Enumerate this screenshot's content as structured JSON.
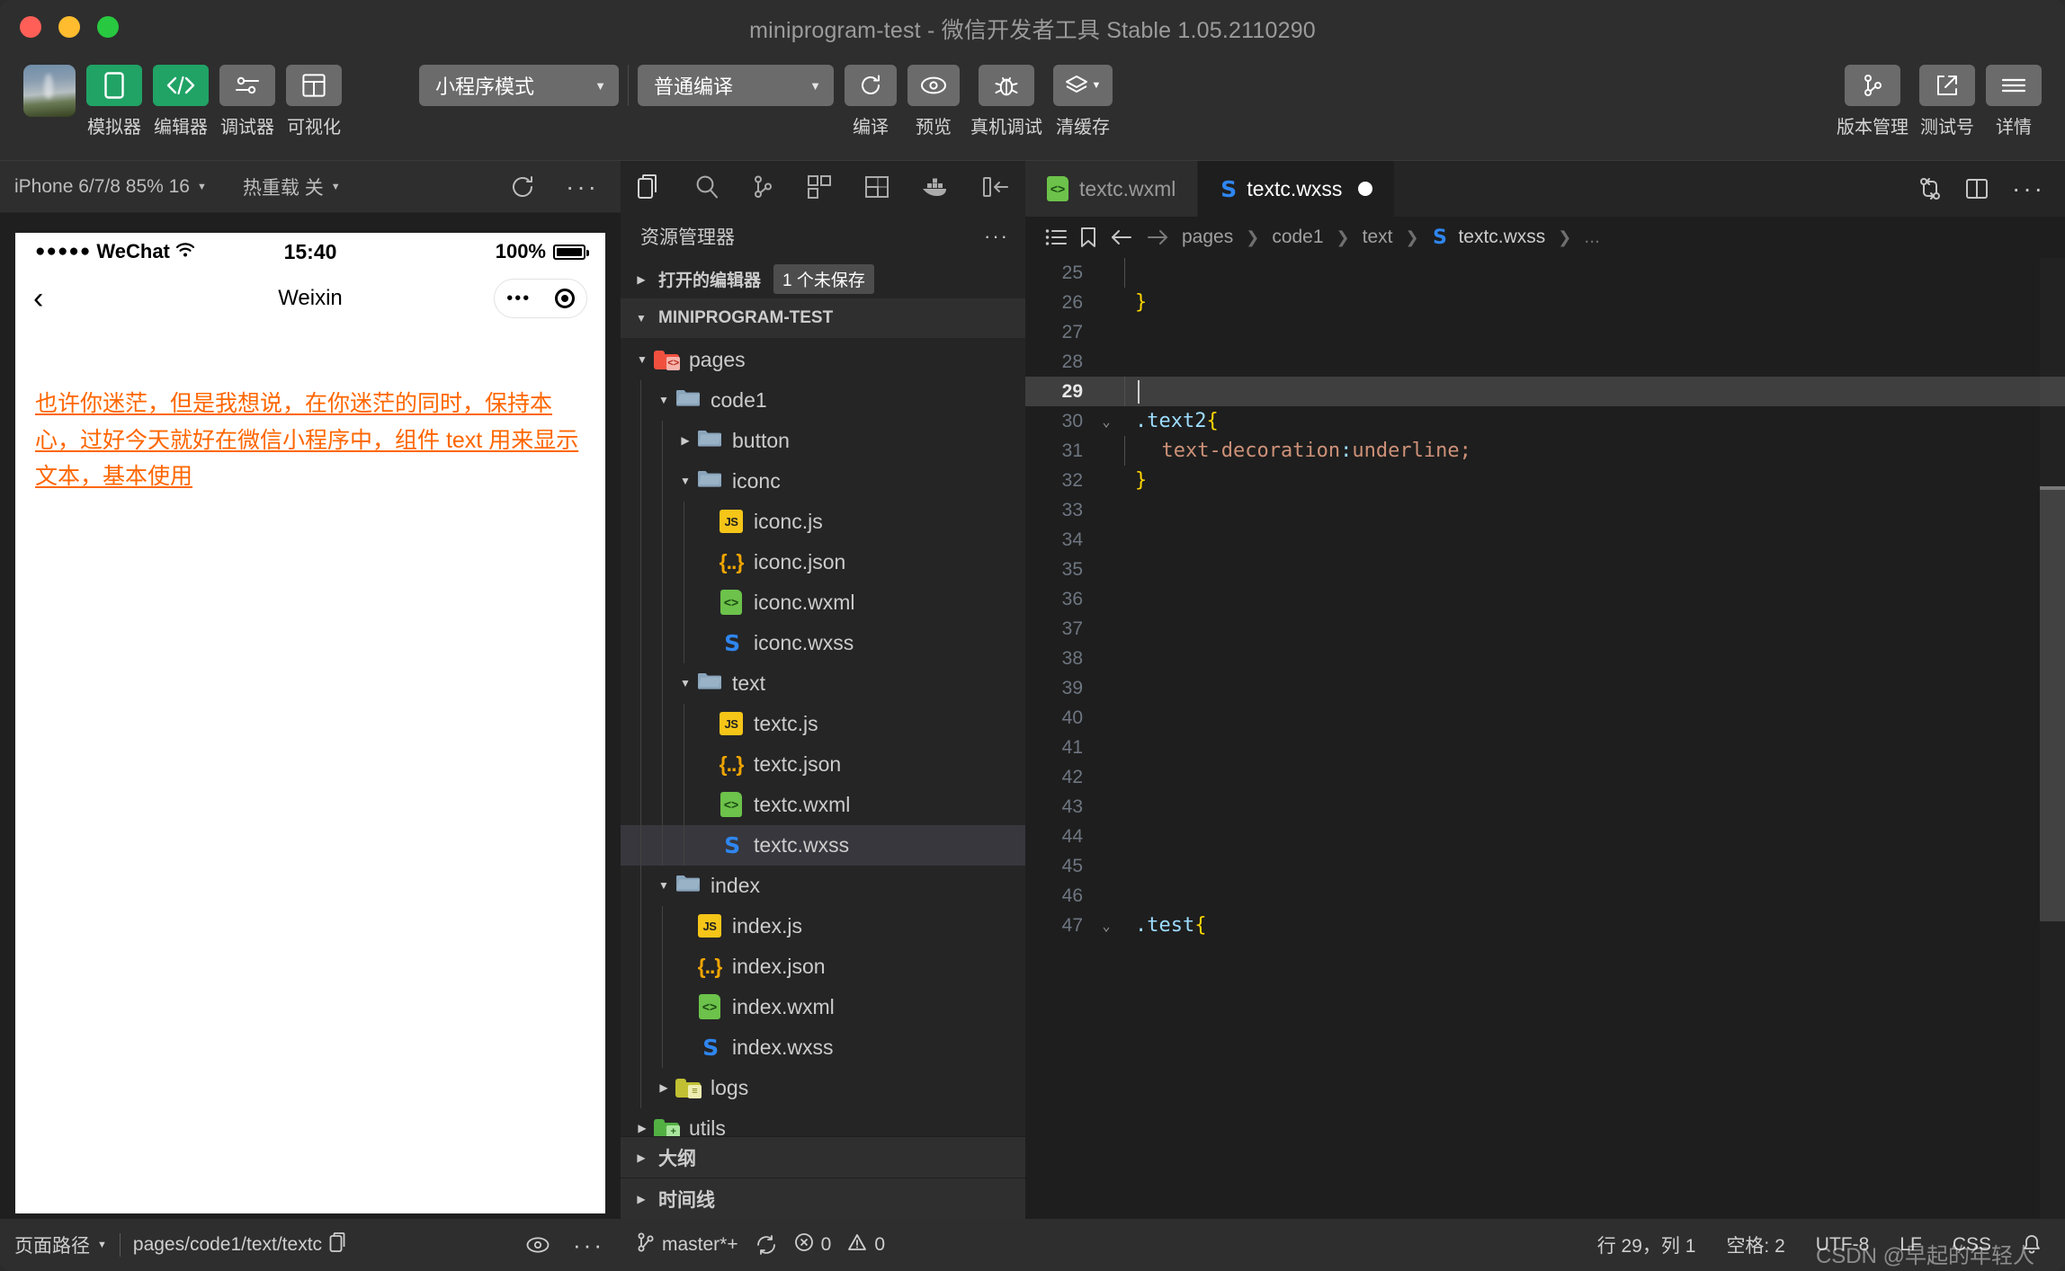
{
  "window": {
    "title": "miniprogram-test - 微信开发者工具 Stable 1.05.2110290"
  },
  "toolbar": {
    "items": [
      {
        "label": "模拟器",
        "icon": "phone-icon"
      },
      {
        "label": "编辑器",
        "icon": "code-icon"
      },
      {
        "label": "调试器",
        "icon": "sliders-icon"
      },
      {
        "label": "可视化",
        "icon": "layout-icon"
      }
    ],
    "mode_select": "小程序模式",
    "compile_select": "普通编译",
    "actions": [
      {
        "label": "编译",
        "icon": "refresh-icon"
      },
      {
        "label": "预览",
        "icon": "eye-icon"
      },
      {
        "label": "真机调试",
        "icon": "bug-icon"
      },
      {
        "label": "清缓存",
        "icon": "layers-icon"
      }
    ],
    "right_actions": [
      {
        "label": "版本管理",
        "icon": "git-branch-icon"
      },
      {
        "label": "测试号",
        "icon": "external-link-icon"
      },
      {
        "label": "详情",
        "icon": "hamburger-icon"
      }
    ]
  },
  "simulator": {
    "device": "iPhone 6/7/8 85% 16",
    "hot_reload": "热重载 关",
    "refresh_icon": "refresh-icon",
    "more_icon": "ellipsis-icon",
    "phone": {
      "carrier": "WeChat",
      "signal_dots": "●●●●●",
      "wifi_icon": "wifi-icon",
      "time": "15:40",
      "battery_percent": "100%",
      "nav_title": "Weixin",
      "back_icon": "chevron-left-icon",
      "capsule_dots": "•••",
      "body_text": "也许你迷茫，但是我想说，在你迷茫的同时，保持本心，过好今天就好在微信小程序中，组件 text 用来显示文本，基本使用",
      "body_text_color": "#ff6600"
    },
    "footer": {
      "page_path_label": "页面路径",
      "page_path_value": "pages/code1/text/textc",
      "copy_icon": "copy-icon",
      "eye_icon": "eye-icon",
      "more_icon": "ellipsis-icon"
    }
  },
  "explorer": {
    "activity_icons": [
      "files-icon",
      "search-icon",
      "source-control-icon",
      "extensions-icon",
      "debug-console-icon",
      "docker-icon",
      "collapse-sidebar-icon"
    ],
    "title": "资源管理器",
    "more_icon": "ellipsis-icon",
    "open_editors": {
      "label": "打开的编辑器",
      "badge": "1 个未保存"
    },
    "root": "MINIPROGRAM-TEST",
    "tree": [
      {
        "label": "pages",
        "type": "folder",
        "icon": "folder-pages",
        "depth": 1,
        "open": true
      },
      {
        "label": "code1",
        "type": "folder",
        "icon": "folder-blue",
        "depth": 2,
        "open": true
      },
      {
        "label": "button",
        "type": "folder",
        "icon": "folder-blue",
        "depth": 3,
        "open": false
      },
      {
        "label": "iconc",
        "type": "folder",
        "icon": "folder-blue",
        "depth": 3,
        "open": true
      },
      {
        "label": "iconc.js",
        "type": "file",
        "icon": "js-icon",
        "depth": 4
      },
      {
        "label": "iconc.json",
        "type": "file",
        "icon": "json-icon",
        "depth": 4
      },
      {
        "label": "iconc.wxml",
        "type": "file",
        "icon": "wxml-icon",
        "depth": 4
      },
      {
        "label": "iconc.wxss",
        "type": "file",
        "icon": "wxss-icon",
        "depth": 4
      },
      {
        "label": "text",
        "type": "folder",
        "icon": "folder-blue",
        "depth": 3,
        "open": true
      },
      {
        "label": "textc.js",
        "type": "file",
        "icon": "js-icon",
        "depth": 4
      },
      {
        "label": "textc.json",
        "type": "file",
        "icon": "json-icon",
        "depth": 4
      },
      {
        "label": "textc.wxml",
        "type": "file",
        "icon": "wxml-icon",
        "depth": 4
      },
      {
        "label": "textc.wxss",
        "type": "file",
        "icon": "wxss-icon",
        "depth": 4,
        "selected": true
      },
      {
        "label": "index",
        "type": "folder",
        "icon": "folder-blue",
        "depth": 2,
        "open": true
      },
      {
        "label": "index.js",
        "type": "file",
        "icon": "js-icon",
        "depth": 3
      },
      {
        "label": "index.json",
        "type": "file",
        "icon": "json-icon",
        "depth": 3
      },
      {
        "label": "index.wxml",
        "type": "file",
        "icon": "wxml-icon",
        "depth": 3
      },
      {
        "label": "index.wxss",
        "type": "file",
        "icon": "wxss-icon",
        "depth": 3
      },
      {
        "label": "logs",
        "type": "folder",
        "icon": "folder-olive",
        "depth": 2,
        "open": false
      },
      {
        "label": "utils",
        "type": "folder",
        "icon": "folder-green",
        "depth": 1,
        "open": false
      }
    ],
    "bottom_sections": [
      "大纲",
      "时间线"
    ]
  },
  "editor": {
    "tabs": [
      {
        "label": "textc.wxml",
        "icon": "wxml-icon",
        "active": false,
        "dirty": false
      },
      {
        "label": "textc.wxss",
        "icon": "wxss-icon",
        "active": true,
        "dirty": true
      }
    ],
    "tab_actions": [
      "split-diff-icon",
      "split-editor-icon",
      "ellipsis-icon"
    ],
    "breadcrumb_icons": [
      "list-icon",
      "bookmark-icon",
      "arrow-left-icon",
      "arrow-right-icon"
    ],
    "breadcrumb": [
      "pages",
      "code1",
      "text",
      "textc.wxss",
      "..."
    ],
    "code": [
      {
        "num": "25",
        "tokens": [],
        "guide": true
      },
      {
        "num": "26",
        "tokens": [
          {
            "t": "}",
            "c": "c-brace"
          }
        ]
      },
      {
        "num": "27",
        "tokens": []
      },
      {
        "num": "28",
        "tokens": []
      },
      {
        "num": "29",
        "tokens": [],
        "highlight": true,
        "cursor": true
      },
      {
        "num": "30",
        "fold": "open",
        "tokens": [
          {
            "t": ".text2",
            "c": "c-key"
          },
          {
            "t": "{",
            "c": "c-brace"
          }
        ]
      },
      {
        "num": "31",
        "guide": true,
        "tokens": [
          {
            "t": "  text-decoration",
            "c": "c-prop"
          },
          {
            "t": ":",
            "c": "c-colon"
          },
          {
            "t": "underline",
            "c": "c-val"
          },
          {
            "t": ";",
            "c": "c-val"
          }
        ]
      },
      {
        "num": "32",
        "tokens": [
          {
            "t": "}",
            "c": "c-brace"
          }
        ]
      },
      {
        "num": "33",
        "tokens": []
      },
      {
        "num": "34",
        "tokens": []
      },
      {
        "num": "35",
        "tokens": []
      },
      {
        "num": "36",
        "tokens": []
      },
      {
        "num": "37",
        "tokens": []
      },
      {
        "num": "38",
        "tokens": []
      },
      {
        "num": "39",
        "tokens": []
      },
      {
        "num": "40",
        "tokens": []
      },
      {
        "num": "41",
        "tokens": []
      },
      {
        "num": "42",
        "tokens": []
      },
      {
        "num": "43",
        "tokens": []
      },
      {
        "num": "44",
        "tokens": []
      },
      {
        "num": "45",
        "tokens": []
      },
      {
        "num": "46",
        "tokens": []
      },
      {
        "num": "47",
        "fold": "open",
        "tokens": [
          {
            "t": ".test",
            "c": "c-key"
          },
          {
            "t": "{",
            "c": "c-brace"
          }
        ]
      }
    ]
  },
  "statusbar": {
    "branch": "master*+",
    "branch_icon": "git-branch-icon",
    "sync_icon": "sync-icon",
    "errors": "0",
    "warnings": "0",
    "error_icon": "error-icon",
    "warning_icon": "warning-icon",
    "cursor_position": "行 29，列 1",
    "indent": "空格: 2",
    "encoding": "UTF-8",
    "eol": "LF",
    "language": "CSS",
    "bell_icon": "bell-icon",
    "watermark": "CSDN @早起的年轻人"
  }
}
